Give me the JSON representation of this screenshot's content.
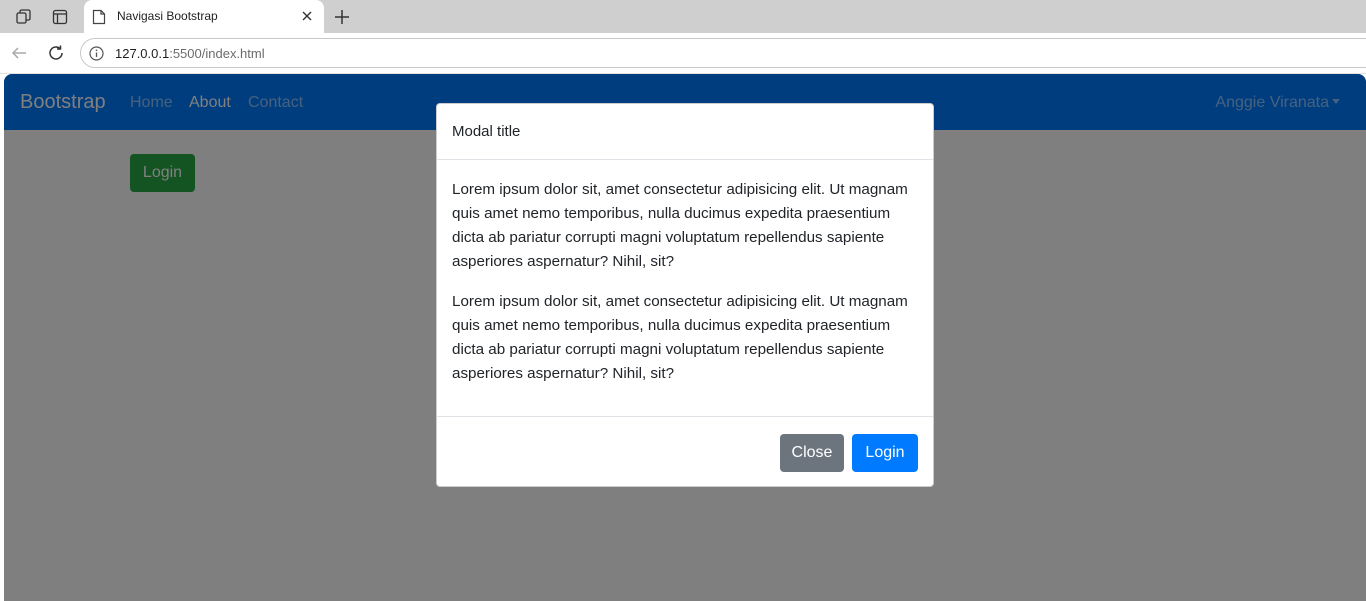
{
  "browser": {
    "tab_title": "Navigasi Bootstrap",
    "url_host": "127.0.0.1",
    "url_rest": ":5500/index.html",
    "icons": [
      "workspaces-icon",
      "tab-actions-icon",
      "page-favicon-icon",
      "tab-close-icon",
      "new-tab-icon",
      "back-icon",
      "reload-icon",
      "site-info-icon"
    ]
  },
  "navbar": {
    "brand": "Bootstrap",
    "links": [
      "Home",
      "About",
      "Contact"
    ],
    "active_link": "About",
    "user": "Anggie Viranata",
    "color": "#007bff"
  },
  "page": {
    "login_button": "Login",
    "login_button_color": "#28a745"
  },
  "modal": {
    "title": "Modal title",
    "paragraphs": [
      "Lorem ipsum dolor sit, amet consectetur adipisicing elit. Ut magnam quis amet nemo temporibus, nulla ducimus expedita praesentium dicta ab pariatur corrupti magni voluptatum repellendus sapiente asperiores aspernatur? Nihil, sit?",
      "Lorem ipsum dolor sit, amet consectetur adipisicing elit. Ut magnam quis amet nemo temporibus, nulla ducimus expedita praesentium dicta ab pariatur corrupti magni voluptatum repellendus sapiente asperiores aspernatur? Nihil, sit?"
    ],
    "close_label": "Close",
    "login_label": "Login",
    "close_color": "#6c757d",
    "login_color": "#007bff"
  }
}
